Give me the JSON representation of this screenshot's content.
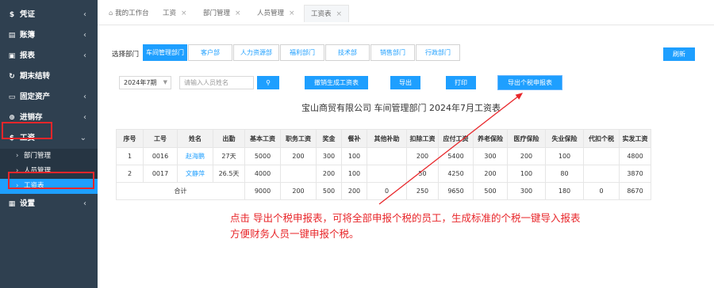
{
  "sidebar": {
    "items": [
      {
        "label": "凭证",
        "icon": "dollar-icon"
      },
      {
        "label": "账簿",
        "icon": "book-icon"
      },
      {
        "label": "报表",
        "icon": "report-icon"
      },
      {
        "label": "期末结转",
        "icon": "refresh-icon"
      },
      {
        "label": "固定资产",
        "icon": "monitor-icon"
      },
      {
        "label": "进销存",
        "icon": "cart-icon"
      },
      {
        "label": "工资",
        "icon": "dollar-icon"
      },
      {
        "label": "设置",
        "icon": "grid-icon"
      }
    ],
    "subitems": [
      {
        "label": "部门管理"
      },
      {
        "label": "人员管理"
      },
      {
        "label": "工资表"
      }
    ]
  },
  "tabs": [
    {
      "label": "我的工作台"
    },
    {
      "label": "工资"
    },
    {
      "label": "部门管理"
    },
    {
      "label": "人员管理"
    },
    {
      "label": "工资表"
    }
  ],
  "depts": {
    "label": "选择部门",
    "items": [
      "车间管理部门",
      "客户部",
      "人力资源部",
      "福利部门",
      "技术部",
      "销售部门",
      "行政部门"
    ]
  },
  "toolbar": {
    "period": "2024年7期",
    "search_placeholder": "请输入人员姓名",
    "revoke_label": "撤销生成工资表",
    "export_label": "导出",
    "print_label": "打印",
    "export_tax_label": "导出个税申报表",
    "refresh_label": "刷新"
  },
  "report_title": "宝山商贸有限公司 车间管理部门 2024年7月工资表",
  "table": {
    "headers": [
      "序号",
      "工号",
      "姓名",
      "出勤",
      "基本工资",
      "职务工资",
      "奖金",
      "餐补",
      "其他补助",
      "扣除工资",
      "应付工资",
      "养老保险",
      "医疗保险",
      "失业保险",
      "代扣个税",
      "实发工资"
    ],
    "rows": [
      [
        "1",
        "0016",
        "赵海鹏",
        "27天",
        "5000",
        "200",
        "300",
        "100",
        "",
        "200",
        "5400",
        "300",
        "200",
        "100",
        "",
        "4800"
      ],
      [
        "2",
        "0017",
        "文静萍",
        "26.5天",
        "4000",
        "",
        "200",
        "100",
        "",
        "50",
        "4250",
        "200",
        "100",
        "80",
        "",
        "3870"
      ]
    ],
    "total": [
      "合计",
      "9000",
      "200",
      "500",
      "200",
      "0",
      "250",
      "9650",
      "500",
      "300",
      "180",
      "0",
      "8670"
    ]
  },
  "annotation": {
    "line1": "点击 导出个税申报表，可将全部申报个税的员工，生成标准的个税一键导入报表",
    "line2": "方便财务人员一键申报个税。"
  },
  "colors": {
    "accent": "#1e9fff",
    "sidebar": "#2f4050",
    "highlight": "#e8262a"
  }
}
